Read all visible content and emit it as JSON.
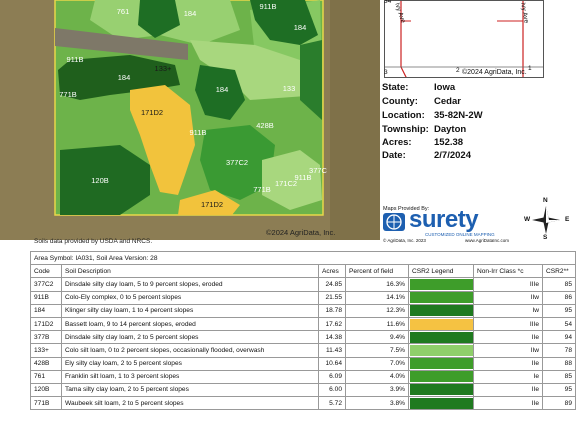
{
  "map": {
    "labels": [
      "761",
      "184",
      "911B",
      "184",
      "911B",
      "133+",
      "771B",
      "184",
      "184",
      "133",
      "171D2",
      "911B",
      "428B",
      "120B",
      "377C2",
      "771B",
      "171C2",
      "911B",
      "377C",
      "171D2"
    ],
    "copyright": "©2024 AgriData, Inc.",
    "source_note": "Soils data provided by USDA and NRCS."
  },
  "locator": {
    "road1": "Ivy Ave",
    "road2": "Ivy Ave",
    "section_left": "3",
    "section_mid": "2",
    "section_right": "1",
    "corner": "34",
    "copyright": "©2024 AgriData, Inc."
  },
  "info": [
    {
      "label": "State:",
      "value": "Iowa"
    },
    {
      "label": "County:",
      "value": "Cedar"
    },
    {
      "label": "Location:",
      "value": "35-82N-2W"
    },
    {
      "label": "Township:",
      "value": "Dayton"
    },
    {
      "label": "Acres:",
      "value": "152.38"
    },
    {
      "label": "Date:",
      "value": "2/7/2024"
    }
  ],
  "branding": {
    "maps_provided_by": "Maps Provided By:",
    "logo": "surety",
    "tagline": "CUSTOMIZED ONLINE MAPPING",
    "footer_left": "© AgriData, Inc. 2023",
    "footer_right": "www.AgriDataInc.com",
    "compass": {
      "n": "N",
      "s": "S",
      "e": "E",
      "w": "W"
    }
  },
  "table": {
    "area_symbol": "Area Symbol: IA031, Soil Area Version: 28",
    "headers": [
      "Code",
      "Soil Description",
      "Acres",
      "Percent of field",
      "CSR2 Legend",
      "Non-Irr Class *c",
      "CSR2**"
    ],
    "rows": [
      {
        "code": "377C2",
        "desc": "Dinsdale silty clay loam, 5 to 9 percent slopes, eroded",
        "acres": "24.85",
        "pct": "16.3%",
        "color": "#3e9d2a",
        "cls": "IIIe",
        "csr2": "85"
      },
      {
        "code": "911B",
        "desc": "Colo-Ely complex, 0 to 5 percent slopes",
        "acres": "21.55",
        "pct": "14.1%",
        "color": "#3e9d2a",
        "cls": "IIw",
        "csr2": "86"
      },
      {
        "code": "184",
        "desc": "Klinger silty clay loam, 1 to 4 percent slopes",
        "acres": "18.78",
        "pct": "12.3%",
        "color": "#1f7a1f",
        "cls": "Iw",
        "csr2": "95"
      },
      {
        "code": "171D2",
        "desc": "Bassett loam, 9 to 14 percent slopes, eroded",
        "acres": "17.62",
        "pct": "11.6%",
        "color": "#f5c242",
        "cls": "IIIe",
        "csr2": "54"
      },
      {
        "code": "377B",
        "desc": "Dinsdale silty clay loam, 2 to 5 percent slopes",
        "acres": "14.38",
        "pct": "9.4%",
        "color": "#1f7a1f",
        "cls": "IIe",
        "csr2": "94"
      },
      {
        "code": "133+",
        "desc": "Colo silt loam, 0 to 2 percent slopes, occasionally flooded, overwash",
        "acres": "11.43",
        "pct": "7.5%",
        "color": "#8fcf6a",
        "cls": "IIw",
        "csr2": "78"
      },
      {
        "code": "428B",
        "desc": "Ely silty clay loam, 2 to 5 percent slopes",
        "acres": "10.64",
        "pct": "7.0%",
        "color": "#3e9d2a",
        "cls": "IIe",
        "csr2": "88"
      },
      {
        "code": "761",
        "desc": "Franklin silt loam, 1 to 3 percent slopes",
        "acres": "6.09",
        "pct": "4.0%",
        "color": "#3e9d2a",
        "cls": "Ie",
        "csr2": "85"
      },
      {
        "code": "120B",
        "desc": "Tama silty clay loam, 2 to 5 percent slopes",
        "acres": "6.00",
        "pct": "3.9%",
        "color": "#1f7a1f",
        "cls": "IIe",
        "csr2": "95"
      },
      {
        "code": "771B",
        "desc": "Waubeek silt loam, 2 to 5 percent slopes",
        "acres": "5.72",
        "pct": "3.8%",
        "color": "#1f7a1f",
        "cls": "IIe",
        "csr2": "89"
      }
    ]
  }
}
